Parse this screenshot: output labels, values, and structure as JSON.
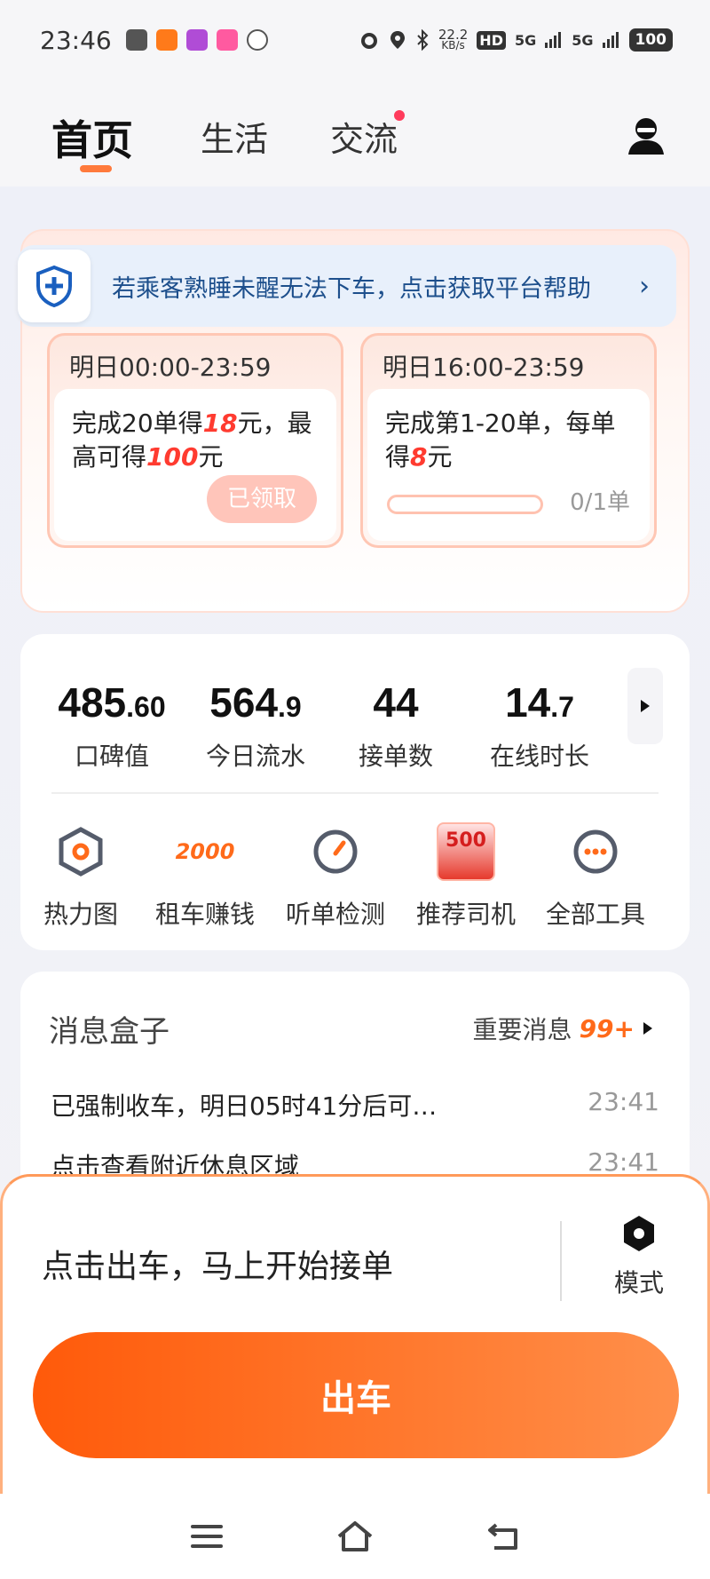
{
  "status_bar": {
    "time": "23:46",
    "net_speed_value": "22.2",
    "net_speed_unit": "KB/s",
    "hd": "HD",
    "signal_1": "5G",
    "signal_2": "5G",
    "battery": "100"
  },
  "nav": {
    "tabs": [
      "首页",
      "生活",
      "交流"
    ],
    "active_tab": "首页"
  },
  "notice": {
    "text": "若乘客熟睡未醒无法下车，点击获取平台帮助",
    "arrow": "›"
  },
  "tasks": [
    {
      "period": "明日00:00-23:59",
      "desc_prefix": "完成20单得",
      "desc_highlight": "18",
      "desc_mid": "元，最高可得",
      "desc_highlight_2": "100",
      "desc_suffix": "元",
      "button": "已领取"
    },
    {
      "period": "明日16:00-23:59",
      "desc_prefix": "完成第1-20单，每单得",
      "desc_highlight": "8",
      "desc_suffix": "元",
      "progress_text": "0/1单",
      "progress": 0
    }
  ],
  "stats": [
    {
      "int": "485",
      "dec": ".60",
      "label": "口碑值"
    },
    {
      "int": "564",
      "dec": ".9",
      "label": "今日流水"
    },
    {
      "int": "44",
      "dec": "",
      "label": "接单数"
    },
    {
      "int": "14",
      "dec": ".7",
      "label": "在线时长"
    }
  ],
  "tools": [
    {
      "label": "热力图",
      "icon": "hexagon-map-icon"
    },
    {
      "label": "租车赚钱",
      "icon": "2000-badge-icon",
      "badge": "2000"
    },
    {
      "label": "听单检测",
      "icon": "gauge-icon"
    },
    {
      "label": "推荐司机",
      "icon": "red-envelope-icon",
      "badge": "500"
    },
    {
      "label": "全部工具",
      "icon": "more-dots-icon"
    }
  ],
  "messages": {
    "title": "消息盒子",
    "important_label": "重要消息",
    "important_count": "99+",
    "items": [
      {
        "text": "已强制收车，明日05时41分后可…",
        "time": "23:41"
      },
      {
        "text": "点击查看附近休息区域",
        "time": "23:41"
      }
    ]
  },
  "dispatch": {
    "prompt": "点击出车，马上开始接单",
    "mode_label": "模式",
    "go_button": "出车"
  },
  "colors": {
    "accent": "#ff6a1a",
    "highlight": "#ff3b30",
    "notice_text": "#1d4f8c"
  }
}
